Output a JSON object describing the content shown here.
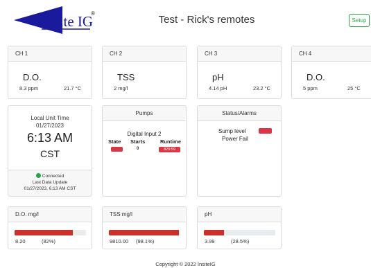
{
  "logo": {
    "text": "Insite IG",
    "mark": "®"
  },
  "page": {
    "title": "Test - Rick's remotes"
  },
  "header": {
    "setup_label": "Setup"
  },
  "channels": [
    {
      "label": "CH 1",
      "name": "D.O.",
      "value1": "8.3 ppm",
      "value2": "21.7 °C"
    },
    {
      "label": "CH 2",
      "name": "TSS",
      "value1": "2 mg/l",
      "value2": ""
    },
    {
      "label": "CH 3",
      "name": "pH",
      "value1": "4.14 pH",
      "value2": "23.2 °C"
    },
    {
      "label": "CH 4",
      "name": "D.O.",
      "value1": "5 ppm",
      "value2": "25 °C"
    }
  ],
  "time": {
    "label": "Local Unit Time",
    "date": "01/27/2023",
    "time": "6:13 AM",
    "zone": "CST",
    "status": "Connected",
    "last_update_label": "Last Data Update",
    "last_update": "01/27/2023, 6:13 AM CST",
    "status_color": "#28a745"
  },
  "pumps": {
    "title": "Pumps",
    "input": "Digital Input 2",
    "headers": {
      "state": "State",
      "starts": "Starts",
      "runtime": "Runtime"
    },
    "starts": "0",
    "runtime": "829:59",
    "state_color": "#dc3545"
  },
  "alarms": {
    "title": "Status/Alarms",
    "items": [
      "Sump level",
      "Power Fail"
    ],
    "alarm_color": "#dc3545"
  },
  "bars": [
    {
      "title": "D.O. mg/l",
      "value": "8.20",
      "percent": "(82%)",
      "fraction": 0.82
    },
    {
      "title": "TSS mg/l",
      "value": "9810.00",
      "percent": "(98.1%)",
      "fraction": 0.981
    },
    {
      "title": "pH",
      "value": "3.99",
      "percent": "(28.5%)",
      "fraction": 0.285
    }
  ],
  "footer": {
    "copyright": "Copyright © 2022 InsiteIG"
  },
  "colors": {
    "accent_green": "#28a745",
    "alert_red": "#dc3545",
    "bar_red": "#c9302c",
    "logo_blue": "#1a1a9c"
  }
}
